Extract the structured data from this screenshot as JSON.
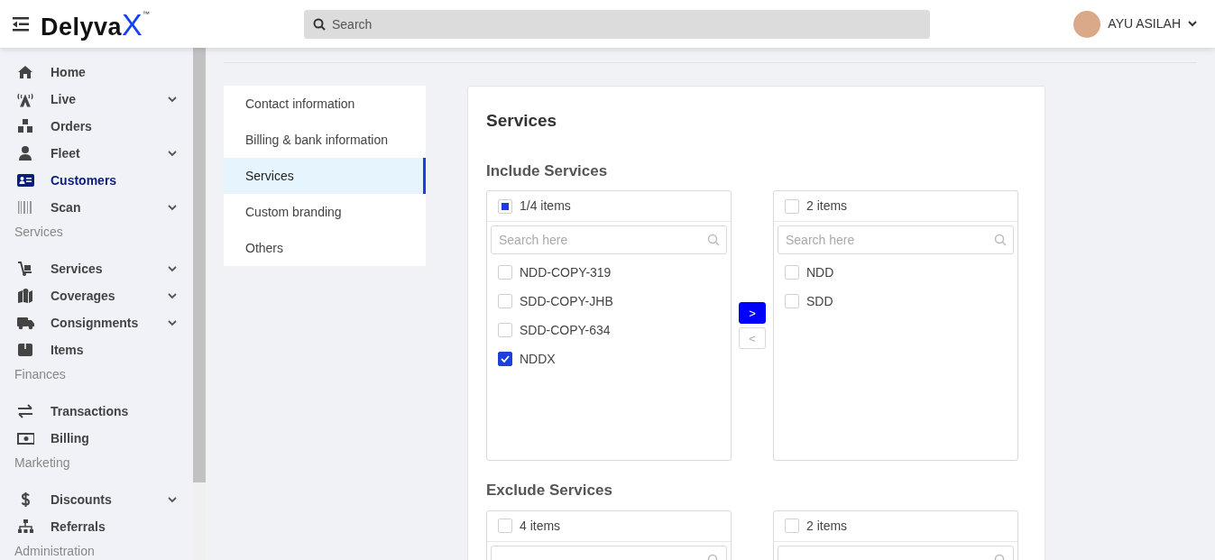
{
  "header": {
    "logo": "Delyva",
    "logo_mark": "X",
    "trademark": "™",
    "search": {
      "placeholder": "Search"
    },
    "user": {
      "name": "AYU ASILAH"
    }
  },
  "sidebar": {
    "items": [
      {
        "kind": "link",
        "label": "Home",
        "expandable": false,
        "selected": false
      },
      {
        "kind": "link",
        "label": "Live",
        "expandable": true,
        "selected": false
      },
      {
        "kind": "link",
        "label": "Orders",
        "expandable": false,
        "selected": false
      },
      {
        "kind": "link",
        "label": "Fleet",
        "expandable": true,
        "selected": false
      },
      {
        "kind": "link",
        "label": "Customers",
        "expandable": false,
        "selected": true
      },
      {
        "kind": "link",
        "label": "Scan",
        "expandable": true,
        "selected": false
      },
      {
        "kind": "heading",
        "label": "Services"
      },
      {
        "kind": "link",
        "label": "Services",
        "expandable": true,
        "selected": false
      },
      {
        "kind": "link",
        "label": "Coverages",
        "expandable": true,
        "selected": false
      },
      {
        "kind": "link",
        "label": "Consignments",
        "expandable": true,
        "selected": false
      },
      {
        "kind": "link",
        "label": "Items",
        "expandable": false,
        "selected": false
      },
      {
        "kind": "heading",
        "label": "Finances"
      },
      {
        "kind": "link",
        "label": "Transactions",
        "expandable": false,
        "selected": false
      },
      {
        "kind": "link",
        "label": "Billing",
        "expandable": false,
        "selected": false
      },
      {
        "kind": "heading",
        "label": "Marketing"
      },
      {
        "kind": "link",
        "label": "Discounts",
        "expandable": true,
        "selected": false
      },
      {
        "kind": "link",
        "label": "Referrals",
        "expandable": false,
        "selected": false
      },
      {
        "kind": "heading",
        "label": "Administration"
      }
    ]
  },
  "settings_nav": [
    {
      "label": "Contact information",
      "selected": false
    },
    {
      "label": "Billing & bank information",
      "selected": false
    },
    {
      "label": "Services",
      "selected": true
    },
    {
      "label": "Custom branding",
      "selected": false
    },
    {
      "label": "Others",
      "selected": false
    }
  ],
  "panel": {
    "title": "Services",
    "sections": [
      {
        "title": "Include Services",
        "lists": [
          {
            "count": "1/4 items",
            "indeterminate": true,
            "search": {
              "placeholder": "Search here"
            },
            "items": [
              {
                "label": "NDD-COPY-319",
                "checked": false
              },
              {
                "label": "SDD-COPY-JHB",
                "checked": false
              },
              {
                "label": "SDD-COPY-634",
                "checked": false
              },
              {
                "label": "NDDX",
                "checked": true
              }
            ]
          },
          {
            "count": "2 items",
            "indeterminate": false,
            "search": {
              "placeholder": "Search here"
            },
            "items": [
              {
                "label": "NDD",
                "checked": false
              },
              {
                "label": "SDD",
                "checked": false
              }
            ]
          }
        ],
        "transfer": [
          {
            "label": ">",
            "disabled": false
          },
          {
            "label": "<",
            "disabled": true
          }
        ]
      },
      {
        "title": "Exclude Services",
        "lists": [
          {
            "count": "4 items",
            "indeterminate": false,
            "search_field": true
          },
          {
            "count": "2 items",
            "indeterminate": false,
            "search_field": true
          }
        ]
      }
    ]
  }
}
